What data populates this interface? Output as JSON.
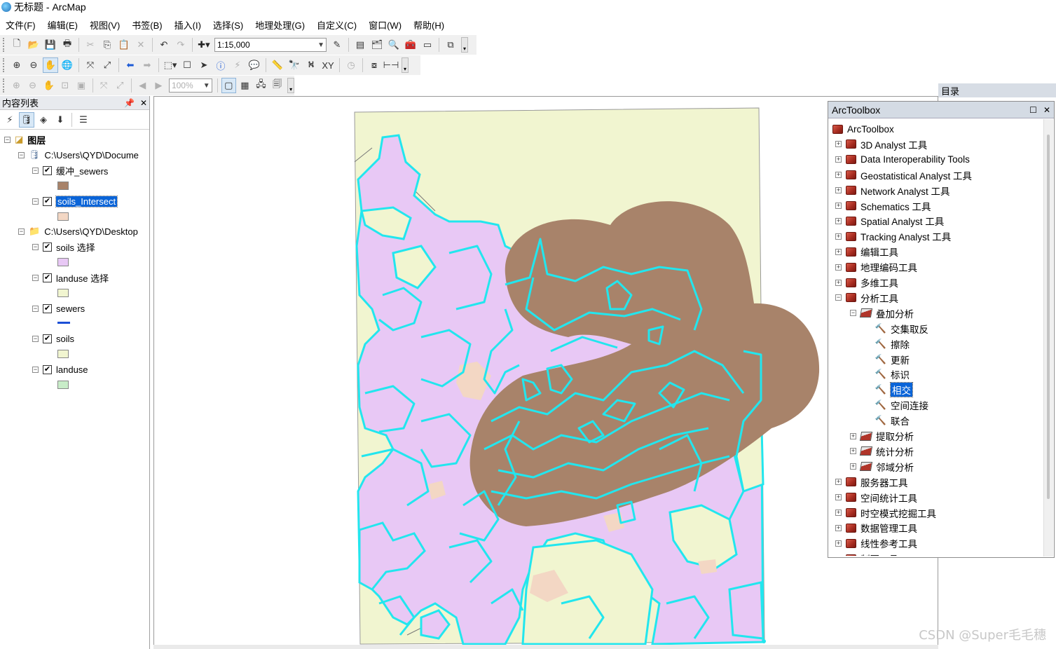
{
  "window": {
    "title": "无标题 - ArcMap"
  },
  "menu": [
    {
      "label": "文件(F)"
    },
    {
      "label": "编辑(E)"
    },
    {
      "label": "视图(V)"
    },
    {
      "label": "书签(B)"
    },
    {
      "label": "插入(I)"
    },
    {
      "label": "选择(S)"
    },
    {
      "label": "地理处理(G)"
    },
    {
      "label": "自定义(C)"
    },
    {
      "label": "窗口(W)"
    },
    {
      "label": "帮助(H)"
    }
  ],
  "toolbar": {
    "scale": "1:15,000",
    "zoom_percent": "100%"
  },
  "toc": {
    "title": "内容列表",
    "root_label": "图层",
    "groups": [
      {
        "path": "C:\\Users\\QYD\\Docume",
        "layers": [
          {
            "name": "缓冲_sewers",
            "swatch": "#a8836a",
            "checked": true
          },
          {
            "name": "soils_Intersect",
            "swatch": "#f3d7c4",
            "checked": true,
            "selected": true
          }
        ]
      },
      {
        "path": "C:\\Users\\QYD\\Desktop",
        "layers": [
          {
            "name": "soils 选择",
            "swatch": "#e8c8f5",
            "checked": true
          },
          {
            "name": "landuse 选择",
            "swatch": "#f1f5d0",
            "checked": true
          },
          {
            "name": "sewers",
            "swatch": "#1c4fd6",
            "checked": true,
            "line": true
          },
          {
            "name": "soils",
            "swatch": "#f1f5d0",
            "checked": true
          },
          {
            "name": "landuse",
            "swatch": "#c8ecc8",
            "checked": true
          }
        ]
      }
    ]
  },
  "catalog_tab": {
    "label": "目录"
  },
  "arctoolbox": {
    "title": "ArcToolbox",
    "root": "ArcToolbox",
    "items": [
      {
        "label": "3D Analyst 工具",
        "level": 1,
        "icon": "toolbox",
        "expander": "+"
      },
      {
        "label": "Data Interoperability Tools",
        "level": 1,
        "icon": "toolbox",
        "expander": "+"
      },
      {
        "label": "Geostatistical Analyst 工具",
        "level": 1,
        "icon": "toolbox",
        "expander": "+"
      },
      {
        "label": "Network Analyst 工具",
        "level": 1,
        "icon": "toolbox",
        "expander": "+"
      },
      {
        "label": "Schematics 工具",
        "level": 1,
        "icon": "toolbox",
        "expander": "+"
      },
      {
        "label": "Spatial Analyst 工具",
        "level": 1,
        "icon": "toolbox",
        "expander": "+"
      },
      {
        "label": "Tracking Analyst 工具",
        "level": 1,
        "icon": "toolbox",
        "expander": "+"
      },
      {
        "label": "编辑工具",
        "level": 1,
        "icon": "toolbox",
        "expander": "+"
      },
      {
        "label": "地理编码工具",
        "level": 1,
        "icon": "toolbox",
        "expander": "+"
      },
      {
        "label": "多维工具",
        "level": 1,
        "icon": "toolbox",
        "expander": "+"
      },
      {
        "label": "分析工具",
        "level": 1,
        "icon": "toolbox",
        "expander": "-"
      },
      {
        "label": "叠加分析",
        "level": 2,
        "icon": "toolset",
        "expander": "-"
      },
      {
        "label": "交集取反",
        "level": 3,
        "icon": "tool",
        "expander": ""
      },
      {
        "label": "擦除",
        "level": 3,
        "icon": "tool",
        "expander": ""
      },
      {
        "label": "更新",
        "level": 3,
        "icon": "tool",
        "expander": ""
      },
      {
        "label": "标识",
        "level": 3,
        "icon": "tool",
        "expander": ""
      },
      {
        "label": "相交",
        "level": 3,
        "icon": "tool",
        "expander": "",
        "selected": true
      },
      {
        "label": "空间连接",
        "level": 3,
        "icon": "tool",
        "expander": ""
      },
      {
        "label": "联合",
        "level": 3,
        "icon": "tool",
        "expander": ""
      },
      {
        "label": "提取分析",
        "level": 2,
        "icon": "toolset",
        "expander": "+"
      },
      {
        "label": "统计分析",
        "level": 2,
        "icon": "toolset",
        "expander": "+"
      },
      {
        "label": "邻域分析",
        "level": 2,
        "icon": "toolset",
        "expander": "+"
      },
      {
        "label": "服务器工具",
        "level": 1,
        "icon": "toolbox",
        "expander": "+"
      },
      {
        "label": "空间统计工具",
        "level": 1,
        "icon": "toolbox",
        "expander": "+"
      },
      {
        "label": "时空模式挖掘工具",
        "level": 1,
        "icon": "toolbox",
        "expander": "+"
      },
      {
        "label": "数据管理工具",
        "level": 1,
        "icon": "toolbox",
        "expander": "+"
      },
      {
        "label": "线性参考工具",
        "level": 1,
        "icon": "toolbox",
        "expander": "+"
      },
      {
        "label": "制图工具",
        "level": 1,
        "icon": "toolbox",
        "expander": "+"
      }
    ]
  },
  "watermark": "CSDN @Super毛毛穗",
  "colors": {
    "landuse": "#f1f5d0",
    "soils_select": "#e8c8f5",
    "buffer": "#a8836a",
    "intersect": "#f3d7c4",
    "sewer_outline": "#22e6ee"
  }
}
